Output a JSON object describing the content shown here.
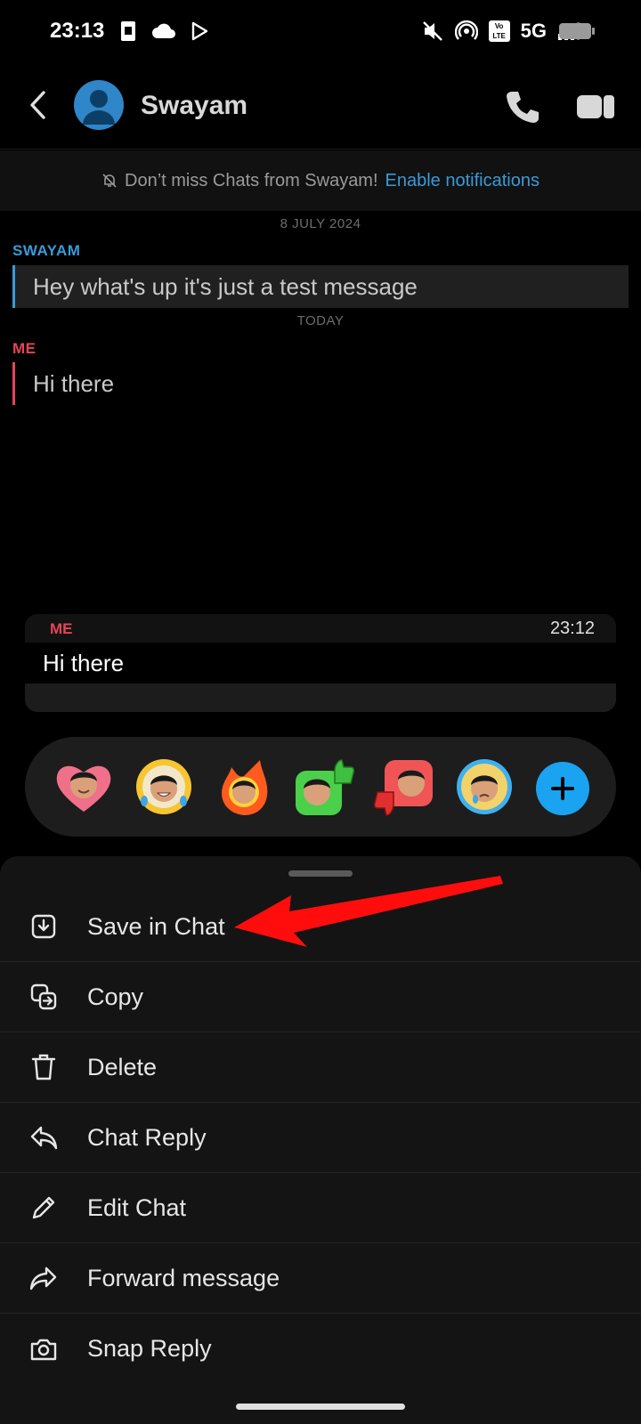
{
  "status_bar": {
    "time": "23:13",
    "network": "5G",
    "volte": "Vo LTE"
  },
  "header": {
    "contact_name": "Swayam"
  },
  "notification_banner": {
    "text": "Don’t miss Chats from Swayam!",
    "link": "Enable notifications"
  },
  "messages": {
    "date_1": "8 JULY 2024",
    "msg_1": {
      "sender": "SWAYAM",
      "text": "Hey what's up it's just a test message"
    },
    "date_2": "TODAY",
    "msg_2": {
      "sender": "ME",
      "text": "Hi there"
    }
  },
  "preview": {
    "sender": "ME",
    "time": "23:12",
    "text": "Hi there"
  },
  "reactions": [
    "heart-face",
    "laughing-tears",
    "fire",
    "thumbs-up",
    "thumbs-down",
    "crying"
  ],
  "menu": {
    "items": [
      {
        "label": "Save in Chat",
        "icon": "save-download-icon"
      },
      {
        "label": "Copy",
        "icon": "copy-icon"
      },
      {
        "label": "Delete",
        "icon": "trash-icon"
      },
      {
        "label": "Chat Reply",
        "icon": "reply-icon"
      },
      {
        "label": "Edit Chat",
        "icon": "pencil-icon"
      },
      {
        "label": "Forward message",
        "icon": "forward-icon"
      },
      {
        "label": "Snap Reply",
        "icon": "camera-icon"
      }
    ]
  },
  "colors": {
    "accent_blue": "#3a9ad9",
    "me_red": "#e44557",
    "annotation_arrow": "#ff0d0d"
  }
}
